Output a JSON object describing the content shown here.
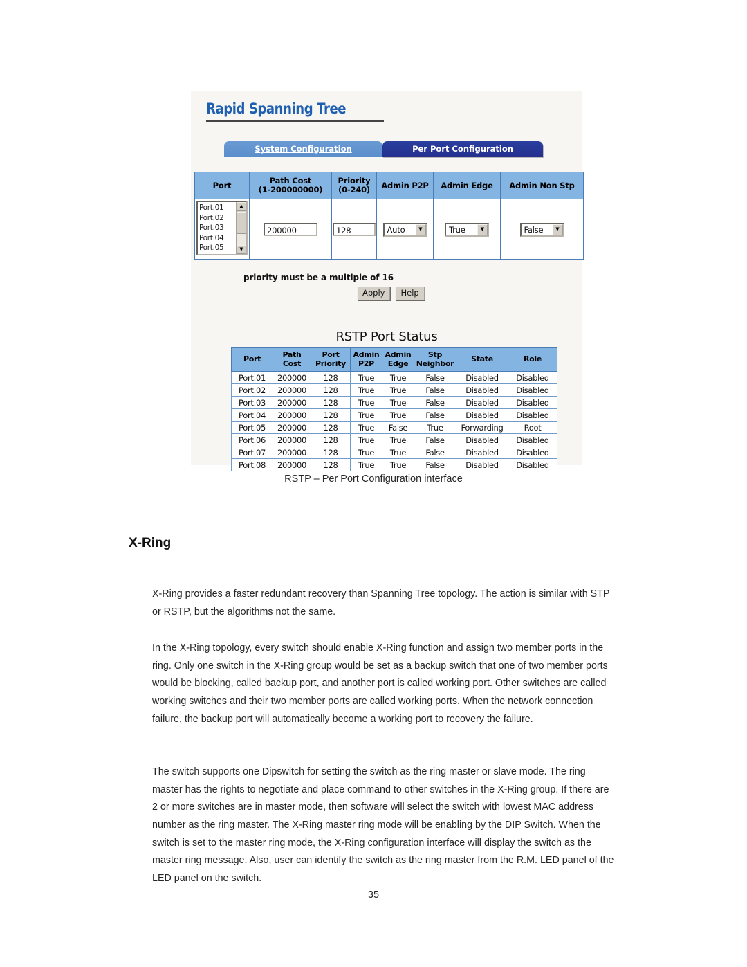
{
  "figure": {
    "app_title": "Rapid Spanning Tree",
    "tabs": [
      {
        "label": "System Configuration",
        "active": false
      },
      {
        "label": "Per Port Configuration",
        "active": true
      }
    ],
    "config_table": {
      "headers": [
        "Port",
        "Path Cost\n(1-200000000)",
        "Priority\n(0-240)",
        "Admin P2P",
        "Admin Edge",
        "Admin Non Stp"
      ],
      "header_port": "Port",
      "header_pathcost_line1": "Path Cost",
      "header_pathcost_line2": "(1-200000000)",
      "header_priority_line1": "Priority",
      "header_priority_line2": "(0-240)",
      "header_admin_p2p": "Admin P2P",
      "header_admin_edge": "Admin Edge",
      "header_admin_nonstp": "Admin Non Stp",
      "port_list": [
        "Port.01",
        "Port.02",
        "Port.03",
        "Port.04",
        "Port.05"
      ],
      "path_cost_value": "200000",
      "priority_value": "128",
      "admin_p2p_value": "Auto",
      "admin_edge_value": "True",
      "admin_non_stp_value": "False"
    },
    "note": "priority must be a multiple of 16",
    "buttons": {
      "apply": "Apply",
      "help": "Help"
    },
    "status": {
      "title": "RSTP Port Status",
      "headers": [
        "Port",
        "Path\nCost",
        "Port\nPriority",
        "Admin\nP2P",
        "Admin\nEdge",
        "Stp\nNeighbor",
        "State",
        "Role"
      ],
      "h_port": "Port",
      "h_pathcost_l1": "Path",
      "h_pathcost_l2": "Cost",
      "h_portpri_l1": "Port",
      "h_portpri_l2": "Priority",
      "h_adminp2p_l1": "Admin",
      "h_adminp2p_l2": "P2P",
      "h_adminedge_l1": "Admin",
      "h_adminedge_l2": "Edge",
      "h_stpneigh_l1": "Stp",
      "h_stpneigh_l2": "Neighbor",
      "h_state": "State",
      "h_role": "Role",
      "rows": [
        [
          "Port.01",
          "200000",
          "128",
          "True",
          "True",
          "False",
          "Disabled",
          "Disabled"
        ],
        [
          "Port.02",
          "200000",
          "128",
          "True",
          "True",
          "False",
          "Disabled",
          "Disabled"
        ],
        [
          "Port.03",
          "200000",
          "128",
          "True",
          "True",
          "False",
          "Disabled",
          "Disabled"
        ],
        [
          "Port.04",
          "200000",
          "128",
          "True",
          "True",
          "False",
          "Disabled",
          "Disabled"
        ],
        [
          "Port.05",
          "200000",
          "128",
          "True",
          "False",
          "True",
          "Forwarding",
          "Root"
        ],
        [
          "Port.06",
          "200000",
          "128",
          "True",
          "True",
          "False",
          "Disabled",
          "Disabled"
        ],
        [
          "Port.07",
          "200000",
          "128",
          "True",
          "True",
          "False",
          "Disabled",
          "Disabled"
        ],
        [
          "Port.08",
          "200000",
          "128",
          "True",
          "True",
          "False",
          "Disabled",
          "Disabled"
        ]
      ]
    },
    "colors": {
      "title_blue": "#1f5fb0",
      "tab_active": "#242f8e",
      "tab_inactive": "#5a8ecb",
      "table_header_blue": "#84b5e2",
      "table_border": "#4a7db5"
    }
  },
  "document": {
    "caption": "RSTP – Per Port Configuration interface",
    "heading": "X-Ring",
    "paragraph_1": "X-Ring provides a faster redundant recovery than Spanning Tree topology. The action is similar with STP or RSTP, but the algorithms not the same.",
    "paragraph_2": "In the X-Ring topology, every switch should enable X-Ring function and assign two member ports in the ring. Only one switch in the X-Ring group would be set as a backup switch that one of two member ports would be blocking, called backup port, and another port is called working port. Other switches are called working switches and their two member ports are called working ports. When the network connection failure, the backup port will automatically become a working port to recovery the failure.",
    "paragraph_3": "The switch supports one Dipswitch for setting the switch as the ring master or slave mode. The ring master has the rights to negotiate and place command to other switches in the X-Ring group.   If there are 2 or more switches are in master mode, then software will select the switch with lowest MAC address number as the ring master. The X-Ring master ring mode will be enabling by the DIP Switch. When the switch is set to the master ring mode, the X-Ring configuration interface will display the switch as the master ring message. Also, user can identify the switch as the ring master from the R.M. LED panel of the LED panel on the switch.",
    "page_number": "35"
  }
}
